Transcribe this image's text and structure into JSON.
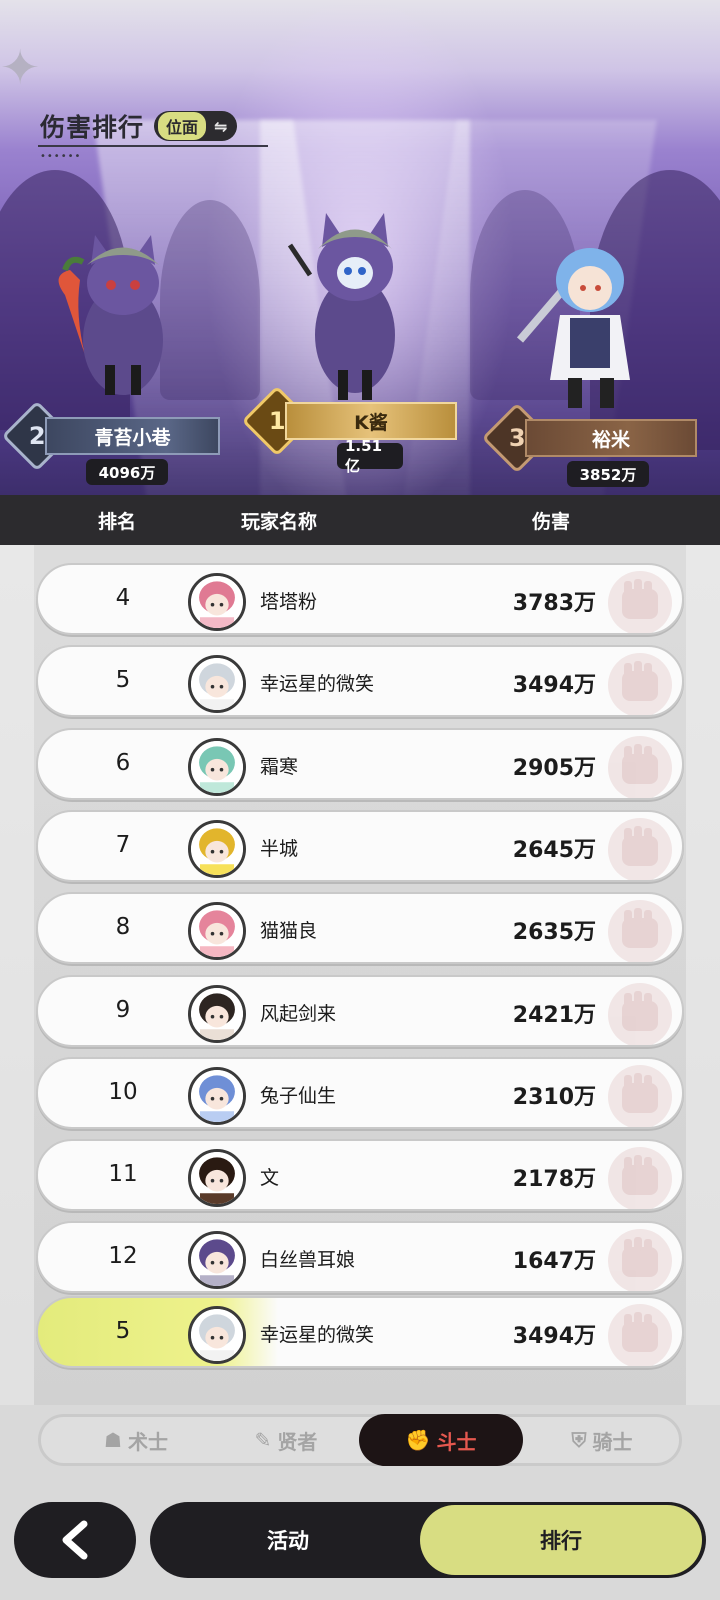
{
  "header": {
    "title": "伤害排行",
    "position_toggle_label": "位面",
    "swap_icon": "⇋"
  },
  "podium": [
    {
      "place": "2",
      "name": "青苔小巷",
      "damage": "4096万",
      "medal": "silver"
    },
    {
      "place": "1",
      "name": "K酱",
      "damage": "1.51亿",
      "medal": "gold"
    },
    {
      "place": "3",
      "name": "裕米",
      "damage": "3852万",
      "medal": "bronze"
    }
  ],
  "table_header": {
    "rank": "排名",
    "player_name": "玩家名称",
    "damage": "伤害"
  },
  "rows": [
    {
      "rank": "4",
      "name": "塔塔粉",
      "damage": "3783万"
    },
    {
      "rank": "5",
      "name": "幸运星的微笑",
      "damage": "3494万"
    },
    {
      "rank": "6",
      "name": "霜寒",
      "damage": "2905万"
    },
    {
      "rank": "7",
      "name": "半城",
      "damage": "2645万"
    },
    {
      "rank": "8",
      "name": "猫猫良",
      "damage": "2635万"
    },
    {
      "rank": "9",
      "name": "风起剑来",
      "damage": "2421万"
    },
    {
      "rank": "10",
      "name": "兔子仙生",
      "damage": "2310万"
    },
    {
      "rank": "11",
      "name": "文",
      "damage": "2178万"
    },
    {
      "rank": "12",
      "name": "白丝兽耳娘",
      "damage": "1647万"
    }
  ],
  "my_row": {
    "rank": "5",
    "name": "幸运星的微笑",
    "damage": "3494万"
  },
  "class_tabs": [
    {
      "label": "术士",
      "icon": "warlock-icon",
      "active": false
    },
    {
      "label": "贤者",
      "icon": "sage-icon",
      "active": false
    },
    {
      "label": "斗士",
      "icon": "fighter-icon",
      "active": true
    },
    {
      "label": "骑士",
      "icon": "knight-icon",
      "active": false
    }
  ],
  "bottom_nav": {
    "back_icon": "back-arrow-icon",
    "activity_label": "活动",
    "ranking_label": "排行"
  },
  "colors": {
    "accent_yellow": "#d8dd82",
    "dark": "#1f1e22",
    "active_tab_text": "#e5584f"
  }
}
